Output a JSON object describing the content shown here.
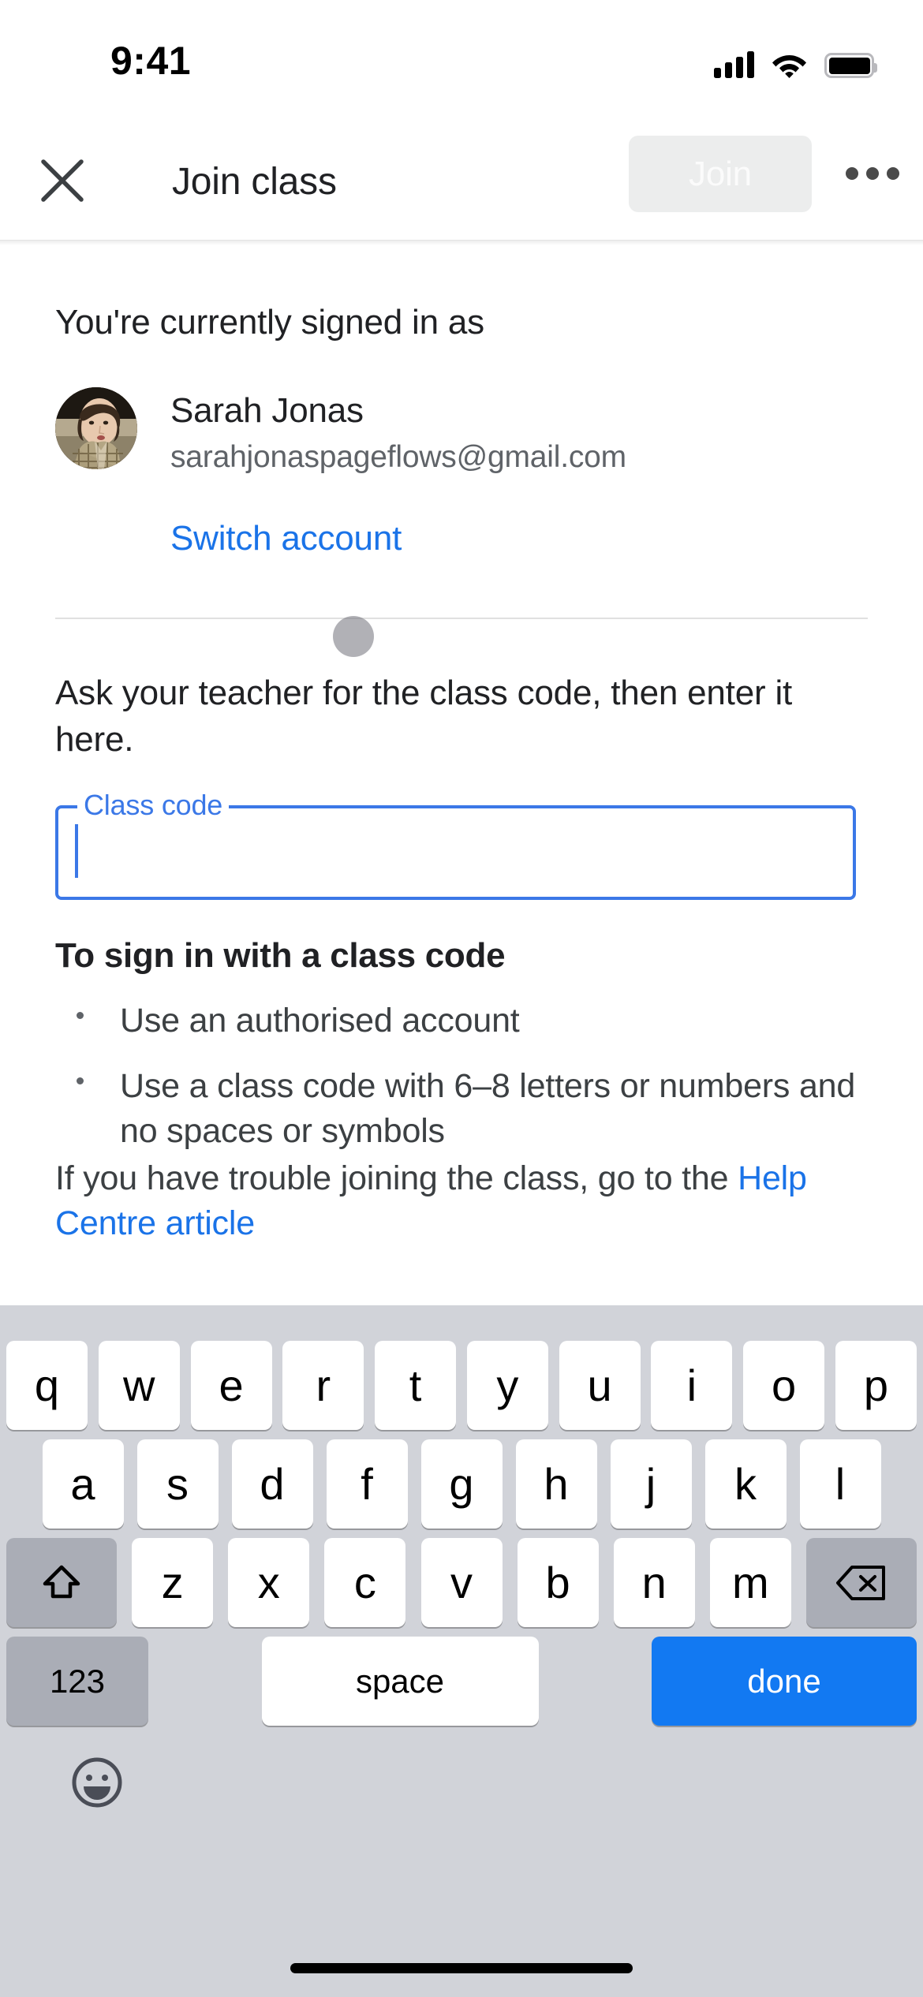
{
  "status_bar": {
    "time": "9:41",
    "icons": [
      "cellular-signal-icon",
      "wifi-icon",
      "battery-icon"
    ]
  },
  "app_bar": {
    "close_icon": "close-icon",
    "title": "Join class",
    "join_label": "Join",
    "join_enabled": false,
    "overflow_icon": "more-options-icon"
  },
  "account": {
    "signed_in_label": "You're currently signed in as",
    "name": "Sarah Jonas",
    "email": "sarahjonaspageflows@gmail.com",
    "switch_link": "Switch account",
    "avatar": "user-avatar"
  },
  "form": {
    "instruction": "Ask your teacher for the class code, then enter it here.",
    "field_label": "Class code",
    "field_value": "",
    "field_focused": true
  },
  "help": {
    "heading": "To sign in with a class code",
    "bullets": [
      "Use an authorised account",
      "Use a class code with 6–8 letters or numbers and no spaces or symbols"
    ],
    "trouble_prefix": "If you have trouble joining the class, go to the ",
    "trouble_link": "Help Centre article"
  },
  "keyboard": {
    "row1": [
      "q",
      "w",
      "e",
      "r",
      "t",
      "y",
      "u",
      "i",
      "o",
      "p"
    ],
    "row2": [
      "a",
      "s",
      "d",
      "f",
      "g",
      "h",
      "j",
      "k",
      "l"
    ],
    "row3": [
      "z",
      "x",
      "c",
      "v",
      "b",
      "n",
      "m"
    ],
    "shift_icon": "shift-icon",
    "backspace_icon": "backspace-icon",
    "numbers_label": "123",
    "space_label": "space",
    "done_label": "done",
    "emoji_icon": "emoji-icon"
  },
  "colors": {
    "accent_blue": "#1a73e8",
    "field_blue": "#3b78e7",
    "done_blue": "#1279f2",
    "keyboard_bg": "#d1d3d9",
    "key_white": "#ffffff",
    "key_gray": "#aaadb6",
    "join_disabled_bg": "#eceded",
    "text_primary": "#202124",
    "text_secondary": "#5f6368"
  }
}
